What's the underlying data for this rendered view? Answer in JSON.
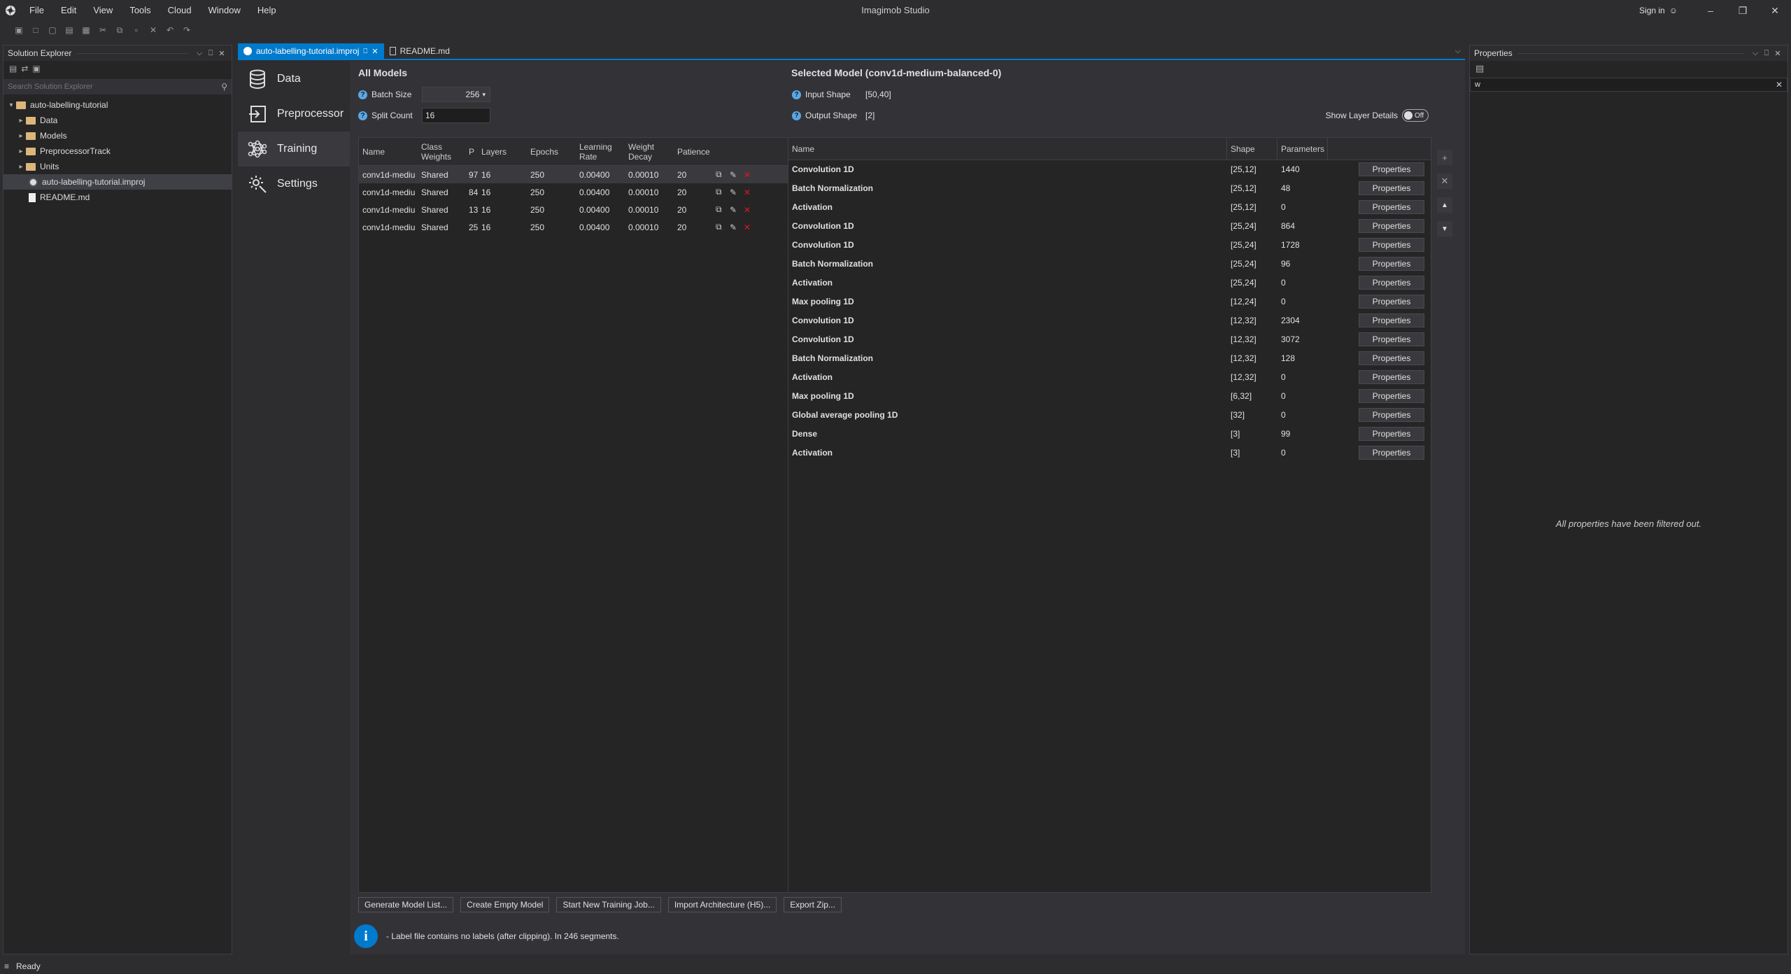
{
  "app": {
    "title": "Imagimob Studio",
    "sign_in": "Sign in"
  },
  "menu": [
    "File",
    "Edit",
    "View",
    "Tools",
    "Cloud",
    "Window",
    "Help"
  ],
  "solution_explorer": {
    "title": "Solution Explorer",
    "search_placeholder": "Search Solution Explorer",
    "root": "auto-labelling-tutorial",
    "items": [
      "Data",
      "Models",
      "PreprocessorTrack",
      "Units"
    ],
    "files": [
      "auto-labelling-tutorial.improj",
      "README.md"
    ]
  },
  "tabs": [
    {
      "label": "auto-labelling-tutorial.improj",
      "active": true
    },
    {
      "label": "README.md",
      "active": false
    }
  ],
  "nav": [
    "Data",
    "Preprocessor",
    "Training",
    "Settings"
  ],
  "all_models": {
    "title": "All Models",
    "batch_size_label": "Batch Size",
    "batch_size_value": "256",
    "split_count_label": "Split Count",
    "split_count_value": "16",
    "columns": [
      "Name",
      "Class Weights",
      "P",
      "Layers",
      "Epochs",
      "Learning Rate",
      "Weight Decay",
      "Patience"
    ],
    "rows": [
      {
        "name": "conv1d-mediu",
        "class_weights": "Shared",
        "p": "97",
        "layers": "16",
        "epochs": "250",
        "lr": "0.00400",
        "wd": "0.00010",
        "patience": "20"
      },
      {
        "name": "conv1d-mediu",
        "class_weights": "Shared",
        "p": "84",
        "layers": "16",
        "epochs": "250",
        "lr": "0.00400",
        "wd": "0.00010",
        "patience": "20"
      },
      {
        "name": "conv1d-mediu",
        "class_weights": "Shared",
        "p": "13",
        "layers": "16",
        "epochs": "250",
        "lr": "0.00400",
        "wd": "0.00010",
        "patience": "20"
      },
      {
        "name": "conv1d-mediu",
        "class_weights": "Shared",
        "p": "25",
        "layers": "16",
        "epochs": "250",
        "lr": "0.00400",
        "wd": "0.00010",
        "patience": "20"
      }
    ]
  },
  "selected_model": {
    "title": "Selected Model (conv1d-medium-balanced-0)",
    "input_shape_label": "Input Shape",
    "input_shape_value": "[50,40]",
    "output_shape_label": "Output Shape",
    "output_shape_value": "[2]",
    "show_layer_details": "Show Layer Details",
    "toggle_state": "Off",
    "columns": [
      "Name",
      "Shape",
      "Parameters"
    ],
    "properties_label": "Properties",
    "layers": [
      {
        "name": "Convolution 1D",
        "shape": "[25,12]",
        "params": "1440"
      },
      {
        "name": "Batch Normalization",
        "shape": "[25,12]",
        "params": "48"
      },
      {
        "name": "Activation",
        "shape": "[25,12]",
        "params": "0"
      },
      {
        "name": "Convolution 1D",
        "shape": "[25,24]",
        "params": "864"
      },
      {
        "name": "Convolution 1D",
        "shape": "[25,24]",
        "params": "1728"
      },
      {
        "name": "Batch Normalization",
        "shape": "[25,24]",
        "params": "96"
      },
      {
        "name": "Activation",
        "shape": "[25,24]",
        "params": "0"
      },
      {
        "name": "Max pooling 1D",
        "shape": "[12,24]",
        "params": "0"
      },
      {
        "name": "Convolution 1D",
        "shape": "[12,32]",
        "params": "2304"
      },
      {
        "name": "Convolution 1D",
        "shape": "[12,32]",
        "params": "3072"
      },
      {
        "name": "Batch Normalization",
        "shape": "[12,32]",
        "params": "128"
      },
      {
        "name": "Activation",
        "shape": "[12,32]",
        "params": "0"
      },
      {
        "name": "Max pooling 1D",
        "shape": "[6,32]",
        "params": "0"
      },
      {
        "name": "Global average pooling 1D",
        "shape": "[32]",
        "params": "0"
      },
      {
        "name": "Dense",
        "shape": "[3]",
        "params": "99"
      },
      {
        "name": "Activation",
        "shape": "[3]",
        "params": "0"
      }
    ]
  },
  "bottom_buttons": [
    "Generate Model List...",
    "Create Empty Model",
    "Start New Training Job...",
    "Import Architecture (H5)...",
    "Export Zip..."
  ],
  "info_message": "- Label file contains no labels (after clipping). In 246 segments.",
  "properties_panel": {
    "title": "Properties",
    "search_value": "w",
    "empty_message": "All properties have been filtered out."
  },
  "status": {
    "text": "Ready"
  },
  "colors": {
    "accent": "#007acc",
    "background": "#1e1e1e",
    "info_icon": "#007acc",
    "delete": "#e81123"
  }
}
